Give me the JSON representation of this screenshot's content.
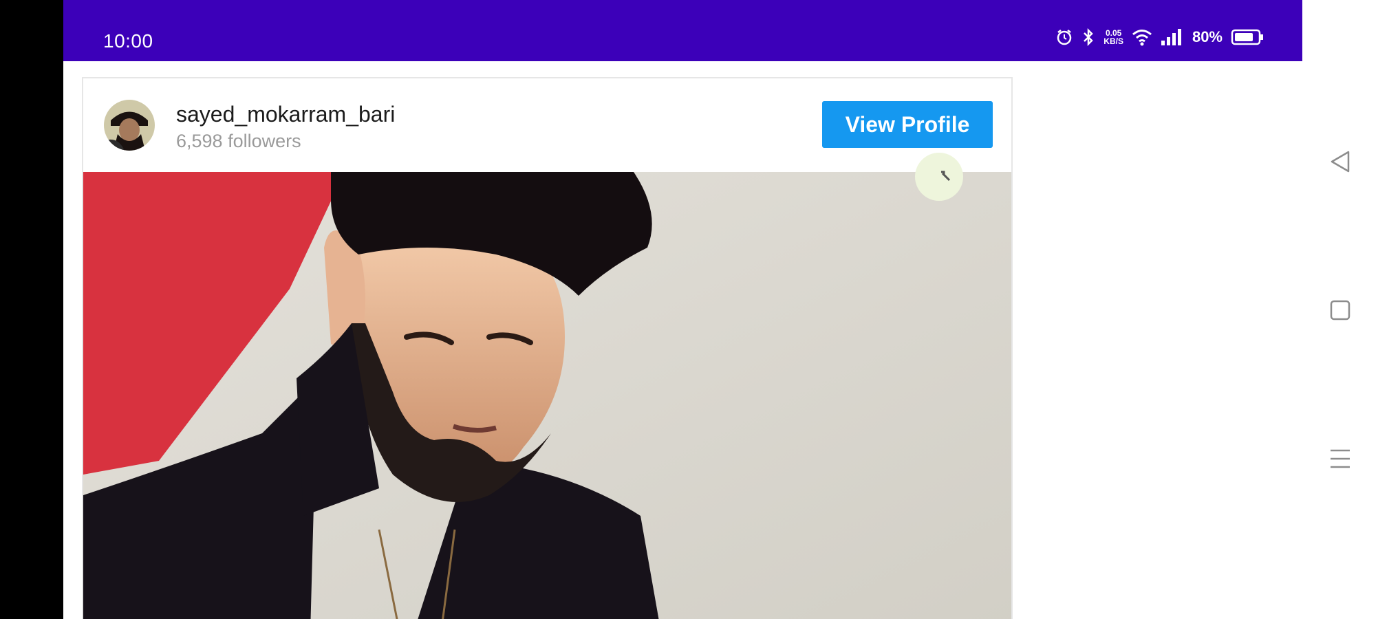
{
  "status_bar": {
    "time": "10:00",
    "speed_top": "0.05",
    "speed_bottom": "KB/S",
    "battery": "80%",
    "icons": [
      "alarm-icon",
      "bluetooth-icon",
      "network-speed",
      "wifi-icon",
      "signal-icon",
      "battery-icon"
    ]
  },
  "post": {
    "username": "sayed_mokarram_bari",
    "followers": "6,598 followers",
    "view_profile_label": "View Profile"
  },
  "colors": {
    "status_bar": "#3c00b9",
    "button": "#1598f0",
    "photo_red": "#d8323f",
    "photo_wall": "#dedbd2"
  },
  "nav": {
    "icons": [
      "back-icon",
      "home-icon",
      "menu-icon"
    ]
  }
}
